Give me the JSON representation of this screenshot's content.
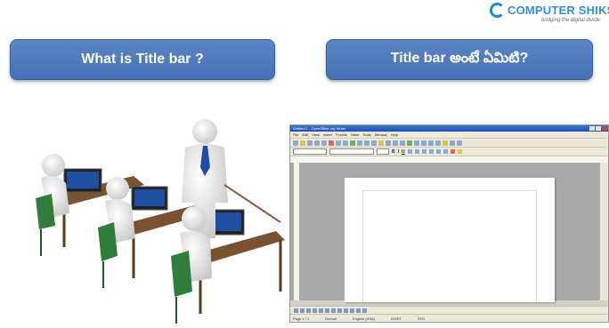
{
  "brand": {
    "name": "COMPUTER SHIKSHA",
    "tagline": "bridging the digital divide",
    "accent_color": "#2d8fe0"
  },
  "questions": {
    "english": "What is Title bar ?",
    "telugu": "Title bar  అంటే ఏమిటి?"
  },
  "illustration": {
    "icon": "office-classroom-figures"
  },
  "writer_window": {
    "title": "Untitled 1 - OpenOffice.org Writer",
    "menus": [
      "File",
      "Edit",
      "View",
      "Insert",
      "Format",
      "Table",
      "Tools",
      "Window",
      "Help"
    ],
    "style_value": "Default",
    "font_value": "Times New Roman",
    "size_value": "12",
    "status": {
      "page": "Page 1 / 1",
      "style": "Default",
      "language": "English (USA)",
      "mode": "INSRT",
      "selection": "STD"
    }
  }
}
